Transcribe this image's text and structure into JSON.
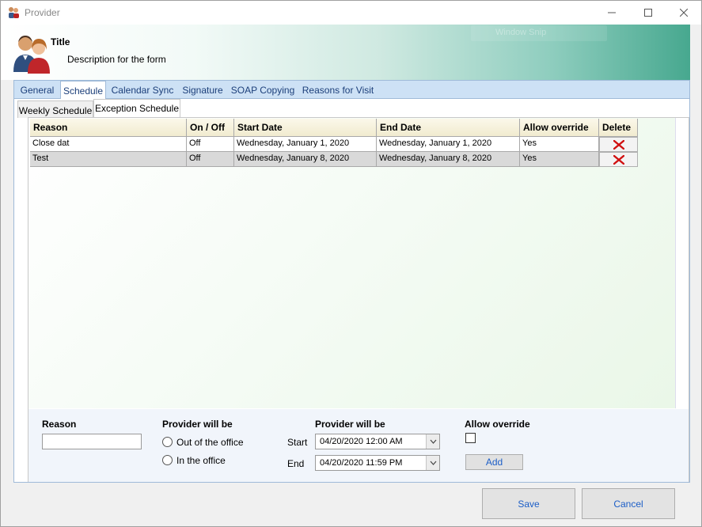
{
  "window": {
    "title": "Provider",
    "controls": {
      "minimize": "minimize-icon",
      "maximize": "maximize-icon",
      "close": "close-icon"
    }
  },
  "header": {
    "title": "Title",
    "description": "Description for the form",
    "ghost_overlay": "Window Snip"
  },
  "tabs": [
    {
      "label": "General"
    },
    {
      "label": "Schedule",
      "active": true
    },
    {
      "label": "Calendar Sync"
    },
    {
      "label": "Signature"
    },
    {
      "label": "SOAP Copying"
    },
    {
      "label": "Reasons for Visit"
    }
  ],
  "subtabs": [
    {
      "label": "Weekly Schedule"
    },
    {
      "label": "Exception Schedule",
      "active": true
    }
  ],
  "grid": {
    "columns": [
      "Reason",
      "On / Off",
      "Start Date",
      "End Date",
      "Allow override",
      "Delete"
    ],
    "rows": [
      {
        "reason": "Close dat",
        "onoff": "Off",
        "start": "Wednesday, January 1, 2020",
        "end": "Wednesday, January 1, 2020",
        "override": "Yes",
        "delete_icon": "delete-x-icon"
      },
      {
        "reason": "Test",
        "onoff": "Off",
        "start": "Wednesday, January 8, 2020",
        "end": "Wednesday, January 8, 2020",
        "override": "Yes",
        "delete_icon": "delete-x-icon"
      }
    ]
  },
  "form": {
    "reason_label": "Reason",
    "reason_value": "",
    "provider_will_be_label_1": "Provider will be",
    "radio_out": "Out of the office",
    "radio_in": "In the office",
    "provider_will_be_label_2": "Provider will be",
    "start_label": "Start",
    "start_value": "04/20/2020 12:00 AM",
    "end_label": "End",
    "end_value": "04/20/2020 11:59 PM",
    "allow_override_label": "Allow override",
    "add_label": "Add"
  },
  "footer": {
    "save_label": "Save",
    "cancel_label": "Cancel"
  },
  "colors": {
    "accent_link": "#1c5ec7",
    "tab_strip": "#cde1f5",
    "banner_end": "#47a88f",
    "delete_icon": "#d01010"
  }
}
